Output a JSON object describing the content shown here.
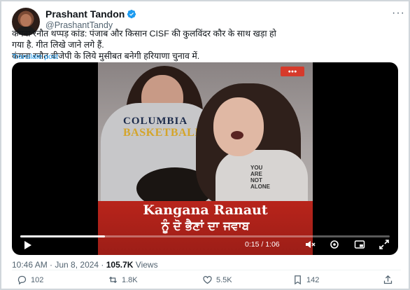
{
  "author": {
    "name": "Prashant Tandon",
    "handle": "@PrashantTandy"
  },
  "tweet": {
    "lines": [
      "कंगना रनौत थप्पड़ कांड: पंजाब और किसान CISF की कुलविंदर कौर के साथ खड़ा हो",
      "गया है. गीत लिखे जाने लगे हैं.",
      "कंगना रनौत बीजेपी के लिये मुसीबत बनेगी हरियाणा चुनाव में."
    ],
    "translate_label": "Translate post"
  },
  "video": {
    "shirt_text_1": "COLUMBIA",
    "shirt_text_2": "BASKETBALL",
    "shirt2_text": "YOU\nARE\nNOT\nALONE",
    "banner_line1": "Kangana Ranaut",
    "banner_line2": "ਨੂੰ ਦੋ ਭੈਣਾਂ ਦਾ ਜਵਾਬ",
    "time": "0:15 / 1:06",
    "progress": 0.23
  },
  "meta": {
    "timestamp": "10:46 AM · Jun 8, 2024 · ",
    "views_count": "105.7K",
    "views_label": " Views"
  },
  "actions": {
    "replies": "102",
    "reposts": "1.8K",
    "likes": "5.5K",
    "bookmarks": "142"
  },
  "colors": {
    "link": "#1d9bf0",
    "banner": "#b8241b",
    "muted": "#536471"
  }
}
